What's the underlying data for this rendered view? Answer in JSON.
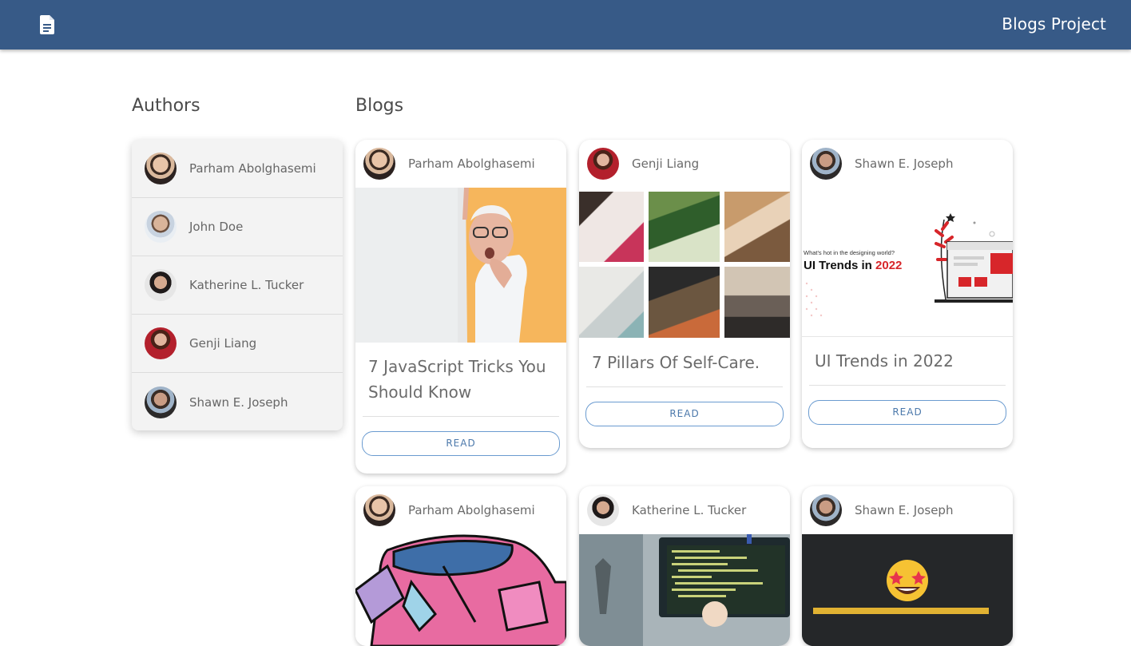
{
  "app": {
    "title": "Blogs Project",
    "logo_icon": "document-icon"
  },
  "authors_title": "Authors",
  "blogs_title": "Blogs",
  "authors": [
    {
      "name": "Parham Abolghasemi"
    },
    {
      "name": "John Doe"
    },
    {
      "name": "Katherine L. Tucker"
    },
    {
      "name": "Genji Liang"
    },
    {
      "name": "Shawn E. Joseph"
    }
  ],
  "blogs": [
    {
      "author": "Parham Abolghasemi",
      "title": "7 JavaScript Tricks You Should Know",
      "read": "READ"
    },
    {
      "author": "Genji Liang",
      "title": "7 Pillars Of Self-Care.",
      "read": "READ"
    },
    {
      "author": "Shawn E. Joseph",
      "title": "UI Trends in 2022",
      "read": "READ",
      "image_text": {
        "tagline": "What's hot in the designing world?",
        "headline_prefix": "UI Trends in",
        "headline_year": "2022"
      }
    },
    {
      "author": "Parham Abolghasemi"
    },
    {
      "author": "Katherine L. Tucker"
    },
    {
      "author": "Shawn E. Joseph"
    }
  ],
  "colors": {
    "appbar": "#375a87",
    "accent": "#4c79ab",
    "year_red": "#d7262a"
  }
}
